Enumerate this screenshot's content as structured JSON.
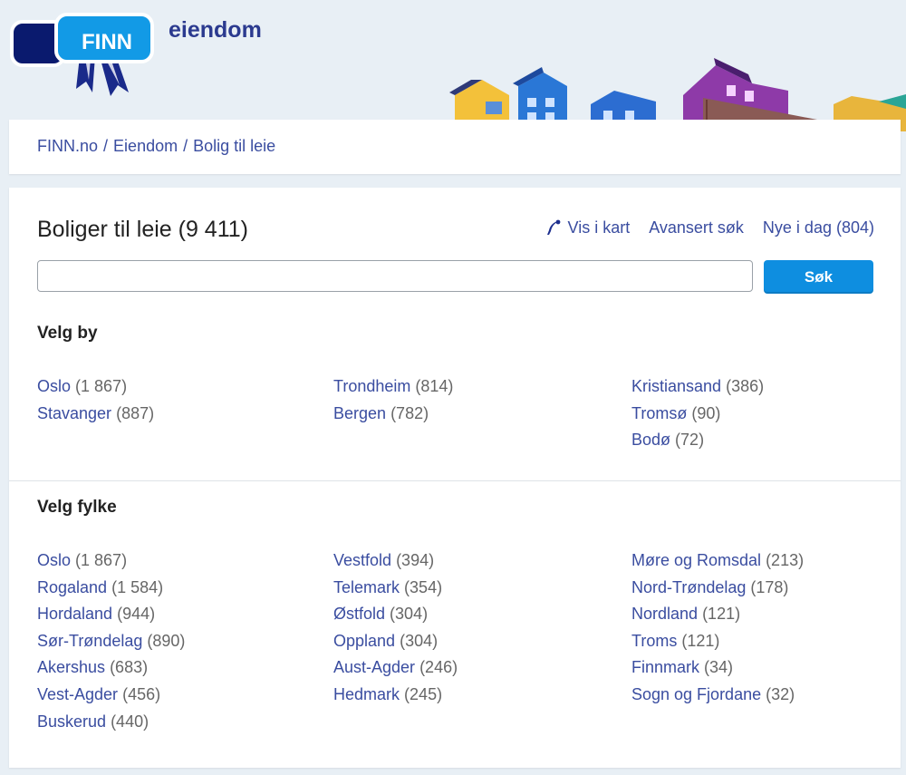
{
  "header": {
    "logo_text": "FINN",
    "site_name": "eiendom"
  },
  "breadcrumb": [
    "FINN.no",
    "Eiendom",
    "Bolig til leie"
  ],
  "page": {
    "title": "Boliger til leie (9 411)",
    "links": {
      "map": "Vis i kart",
      "advanced": "Avansert søk",
      "new_today": "Nye i dag (804)"
    },
    "search": {
      "value": "",
      "button": "Søk"
    }
  },
  "cities": {
    "title": "Velg by",
    "columns": [
      [
        {
          "name": "Oslo",
          "count": "(1 867)"
        },
        {
          "name": "Stavanger",
          "count": "(887)"
        }
      ],
      [
        {
          "name": "Trondheim",
          "count": "(814)"
        },
        {
          "name": "Bergen",
          "count": "(782)"
        }
      ],
      [
        {
          "name": "Kristiansand",
          "count": "(386)"
        },
        {
          "name": "Tromsø",
          "count": "(90)"
        },
        {
          "name": "Bodø",
          "count": "(72)"
        }
      ]
    ]
  },
  "counties": {
    "title": "Velg fylke",
    "columns": [
      [
        {
          "name": "Oslo",
          "count": "(1 867)"
        },
        {
          "name": "Rogaland",
          "count": "(1 584)"
        },
        {
          "name": "Hordaland",
          "count": "(944)"
        },
        {
          "name": "Sør-Trøndelag",
          "count": "(890)"
        },
        {
          "name": "Akershus",
          "count": "(683)"
        },
        {
          "name": "Vest-Agder",
          "count": "(456)"
        },
        {
          "name": "Buskerud",
          "count": "(440)"
        }
      ],
      [
        {
          "name": "Vestfold",
          "count": "(394)"
        },
        {
          "name": "Telemark",
          "count": "(354)"
        },
        {
          "name": "Østfold",
          "count": "(304)"
        },
        {
          "name": "Oppland",
          "count": "(304)"
        },
        {
          "name": "Aust-Agder",
          "count": "(246)"
        },
        {
          "name": "Hedmark",
          "count": "(245)"
        }
      ],
      [
        {
          "name": "Møre og Romsdal",
          "count": "(213)"
        },
        {
          "name": "Nord-Trøndelag",
          "count": "(178)"
        },
        {
          "name": "Nordland",
          "count": "(121)"
        },
        {
          "name": "Troms",
          "count": "(121)"
        },
        {
          "name": "Finnmark",
          "count": "(34)"
        },
        {
          "name": "Sogn og Fjordane",
          "count": "(32)"
        }
      ]
    ]
  },
  "colors": {
    "link": "#3a4da0",
    "brand_blue": "#0e8ee0",
    "brand_navy": "#0a1a6e"
  }
}
